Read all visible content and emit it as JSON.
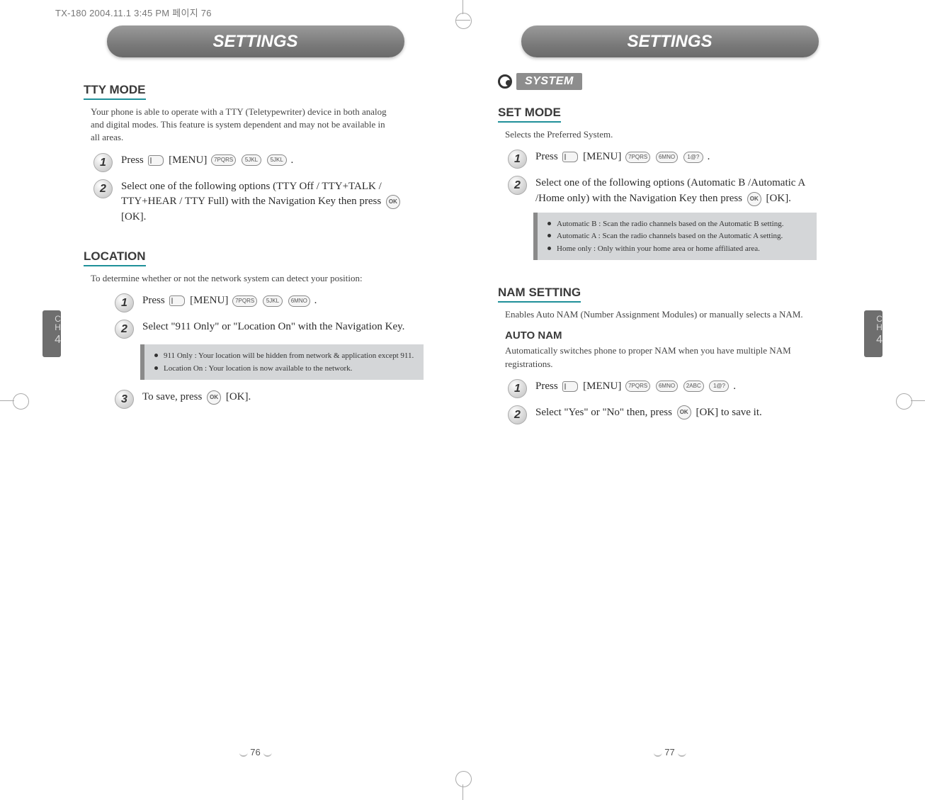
{
  "meta_header": "TX-180  2004.11.1 3:45 PM  페이지 76",
  "left": {
    "title": "SETTINGS",
    "side_tab": {
      "ch": "CH",
      "num": "4"
    },
    "page_num": "76",
    "tty": {
      "heading": "TTY MODE",
      "desc": "Your phone is able to operate with a TTY (Teletypewriter) device in both analog and digital modes. This feature is system dependent and may not be available in all areas.",
      "step1": {
        "badge": "1",
        "pre": "Press",
        "menu": "[MENU]",
        "keys": [
          "7PQRS",
          "5JKL",
          "5JKL"
        ],
        "post": "."
      },
      "step2": {
        "badge": "2",
        "text": "Select one of the following options (TTY Off / TTY+TALK / TTY+HEAR / TTY Full) with the Navigation Key then press",
        "ok": "OK",
        "post": "[OK]."
      }
    },
    "location": {
      "heading": "LOCATION",
      "desc": "To determine whether or not the network system can detect your position:",
      "step1": {
        "badge": "1",
        "pre": "Press",
        "menu": "[MENU]",
        "keys": [
          "7PQRS",
          "5JKL",
          "6MNO"
        ],
        "post": "."
      },
      "step2": {
        "badge": "2",
        "text": "Select \"911 Only\" or \"Location On\" with the Navigation Key."
      },
      "info": [
        "911 Only : Your location will be hidden from network & application except 911.",
        "Location On : Your location is now available to the network."
      ],
      "step3": {
        "badge": "3",
        "text": "To save, press",
        "ok": "OK",
        "post": "[OK]."
      }
    }
  },
  "right": {
    "title": "SETTINGS",
    "side_tab": {
      "ch": "CH",
      "num": "4"
    },
    "page_num": "77",
    "system_label": "SYSTEM",
    "setmode": {
      "heading": "SET MODE",
      "desc": "Selects the Preferred System.",
      "step1": {
        "badge": "1",
        "pre": "Press",
        "menu": "[MENU]",
        "keys": [
          "7PQRS",
          "6MNO",
          "1@?"
        ],
        "post": "."
      },
      "step2": {
        "badge": "2",
        "text": "Select one of the following options (Automatic B /Automatic A /Home only) with the Navigation Key then press",
        "ok": "OK",
        "post": "[OK]."
      },
      "info": [
        "Automatic B : Scan the radio channels based on the Automatic B setting.",
        "Automatic A : Scan the radio channels based on the Automatic A setting.",
        "Home only : Only within your home area or home affiliated area."
      ]
    },
    "nam": {
      "heading": "NAM SETTING",
      "desc": "Enables Auto NAM (Number Assignment Modules) or manually selects a NAM.",
      "auto": {
        "heading": "AUTO NAM",
        "desc": "Automatically switches phone to proper NAM when you have multiple NAM registrations.",
        "step1": {
          "badge": "1",
          "pre": "Press",
          "menu": "[MENU]",
          "keys": [
            "7PQRS",
            "6MNO",
            "2ABC",
            "1@?"
          ],
          "post": "."
        },
        "step2": {
          "badge": "2",
          "text": "Select \"Yes\" or \"No\" then, press",
          "ok": "OK",
          "post": "[OK] to save it."
        }
      }
    }
  }
}
